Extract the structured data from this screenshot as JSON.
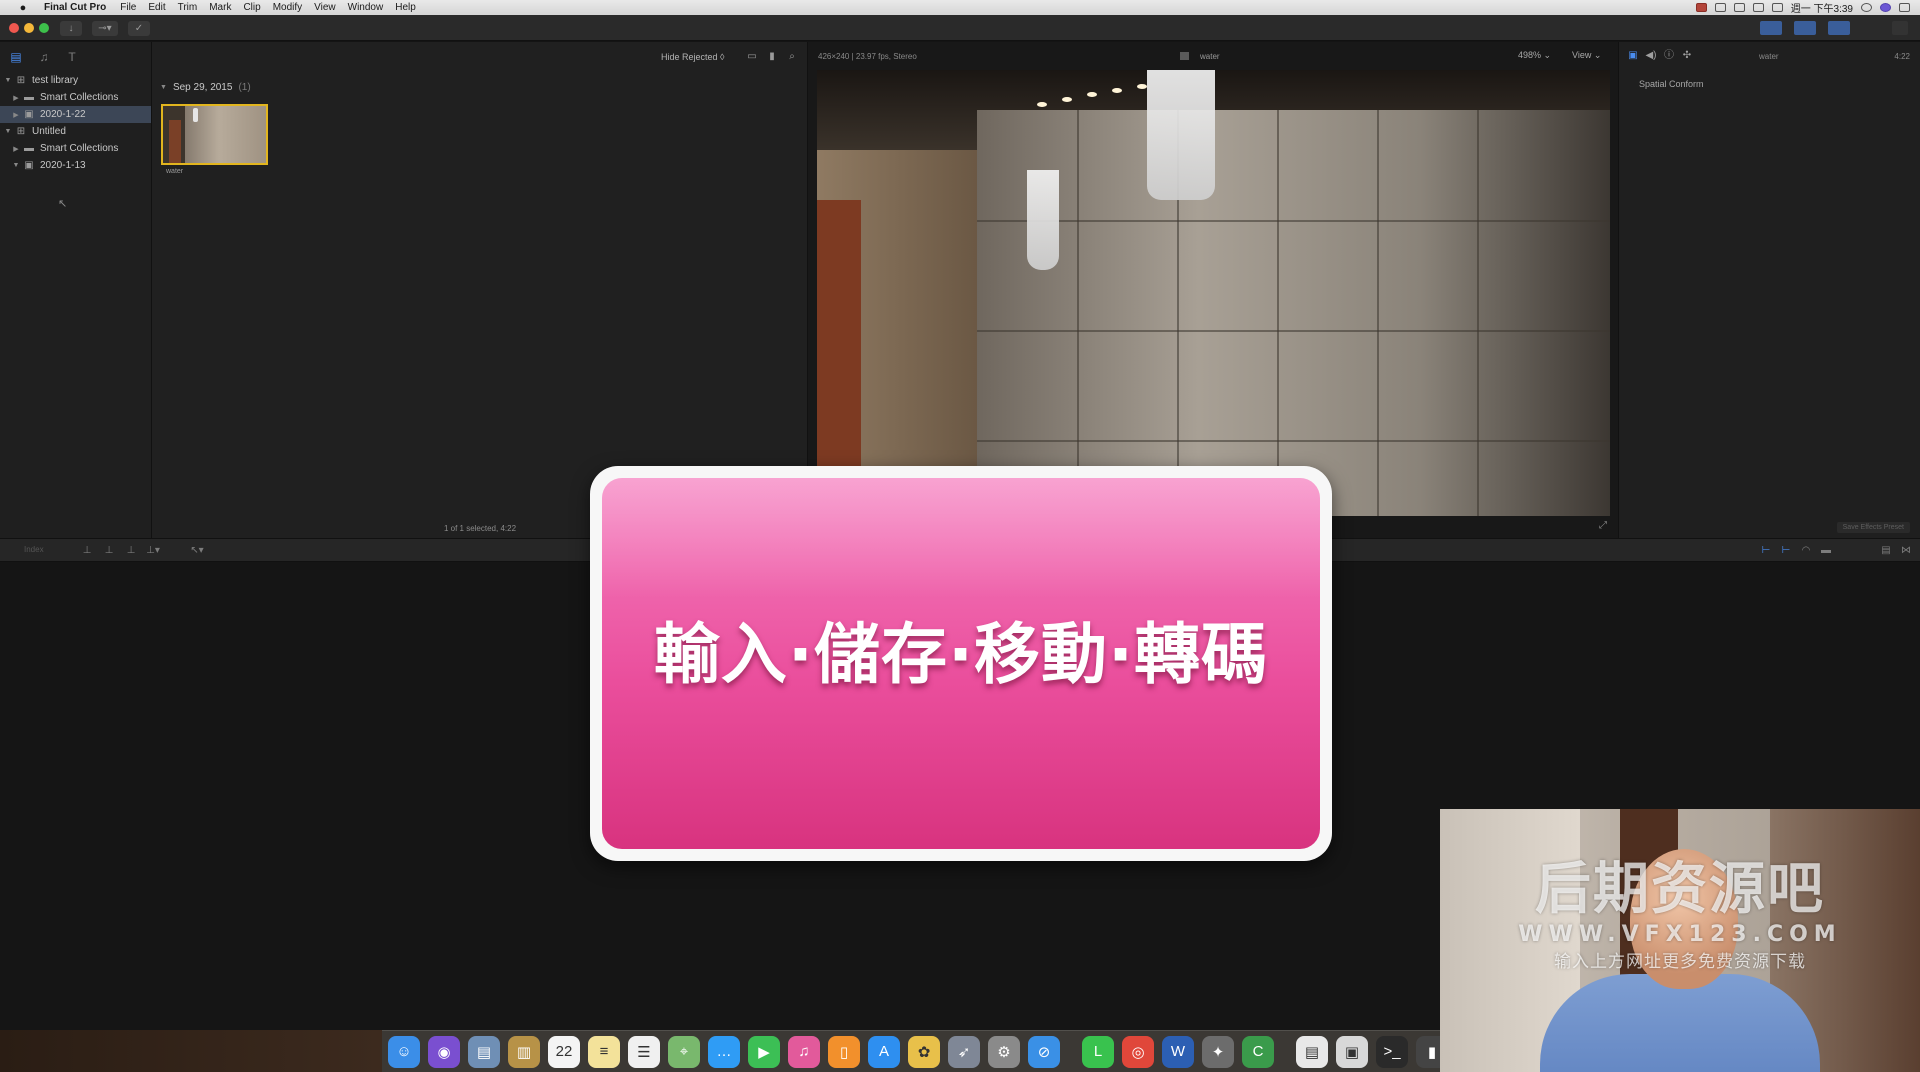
{
  "menubar": {
    "app_name": "Final Cut Pro",
    "items": [
      "File",
      "Edit",
      "Trim",
      "Mark",
      "Clip",
      "Modify",
      "View",
      "Window",
      "Help"
    ],
    "clock": "週一 下午3:39"
  },
  "sidebar": {
    "items": [
      {
        "label": "test library",
        "glyph": "⊞",
        "expanded": true
      },
      {
        "label": "Smart Collections",
        "glyph": "▬",
        "expanded": false
      },
      {
        "label": "2020-1-22",
        "glyph": "▣",
        "expanded": false,
        "selected": true
      },
      {
        "label": "Untitled",
        "glyph": "⊞",
        "expanded": true
      },
      {
        "label": "Smart Collections",
        "glyph": "▬",
        "expanded": false
      },
      {
        "label": "2020-1-13",
        "glyph": "▣",
        "expanded": true
      }
    ]
  },
  "browser": {
    "filter_label": "Hide Rejected ◊",
    "date_group": "Sep 29, 2015",
    "date_count": "(1)",
    "clip_name": "water",
    "status": "1 of 1 selected, 4:22"
  },
  "viewer": {
    "format_info": "426×240 | 23.97 fps, Stereo",
    "clip_name": "water",
    "zoom": "498% ⌄",
    "view_menu": "View ⌄"
  },
  "inspector": {
    "clip_name": "water",
    "duration": "4:22",
    "section_label": "Spatial Conform",
    "save_preset": "Save Effects Preset"
  },
  "timeline": {
    "index_label": "Index"
  },
  "title_card": {
    "text": "輸入·儲存·移動·轉碼"
  },
  "watermark": {
    "title": "后期资源吧",
    "url": "WWW.VFX123.COM",
    "note": "输入上方网址更多免费资源下载"
  },
  "dock": {
    "icons": [
      {
        "name": "finder-icon",
        "glyph": "☺",
        "color": "#3b8ee8"
      },
      {
        "name": "siri-icon",
        "glyph": "◉",
        "color": "#7a4fd0"
      },
      {
        "name": "preview-icon",
        "glyph": "▤",
        "color": "#6f8fb5"
      },
      {
        "name": "notes-folder-icon",
        "glyph": "▥",
        "color": "#b79247"
      },
      {
        "name": "calendar-icon",
        "glyph": "22",
        "color": "#f4f4f4"
      },
      {
        "name": "notes-icon",
        "glyph": "≡",
        "color": "#f3e29a"
      },
      {
        "name": "reminders-icon",
        "glyph": "☰",
        "color": "#f0f0f0"
      },
      {
        "name": "maps-icon",
        "glyph": "⌖",
        "color": "#79b86d"
      },
      {
        "name": "messages-icon",
        "glyph": "…",
        "color": "#2f9cf5"
      },
      {
        "name": "facetime-icon",
        "glyph": "▶",
        "color": "#3cbf55"
      },
      {
        "name": "itunes-icon",
        "glyph": "♫",
        "color": "#e25a9b"
      },
      {
        "name": "ibooks-icon",
        "glyph": "▯",
        "color": "#f2902c"
      },
      {
        "name": "app-store-icon",
        "glyph": "A",
        "color": "#2e8ff0"
      },
      {
        "name": "photos-icon",
        "glyph": "✿",
        "color": "#e8c04a"
      },
      {
        "name": "launchpad-icon",
        "glyph": "➶",
        "color": "#7f8796"
      },
      {
        "name": "system-preferences-icon",
        "glyph": "⚙",
        "color": "#8a8a8a"
      },
      {
        "name": "safari-icon",
        "glyph": "⊘",
        "color": "#3a90e6"
      },
      {
        "name": "line-icon",
        "glyph": "L",
        "color": "#39c24e"
      },
      {
        "name": "chrome-icon",
        "glyph": "◎",
        "color": "#e0473a"
      },
      {
        "name": "word-icon",
        "glyph": "W",
        "color": "#2c5fb3"
      },
      {
        "name": "final-cut-pro-icon",
        "glyph": "✦",
        "color": "#6c6c6c"
      },
      {
        "name": "motion-icon",
        "glyph": "C",
        "color": "#3a9b4b"
      },
      {
        "name": "documents-icon",
        "glyph": "▤",
        "color": "#e8e8e8"
      },
      {
        "name": "screenshots-icon",
        "glyph": "▣",
        "color": "#d8d8d8"
      },
      {
        "name": "terminal-icon",
        "glyph": ">_",
        "color": "#2a2a2a"
      },
      {
        "name": "trash-icon",
        "glyph": "▮",
        "color": "#444444"
      }
    ]
  }
}
